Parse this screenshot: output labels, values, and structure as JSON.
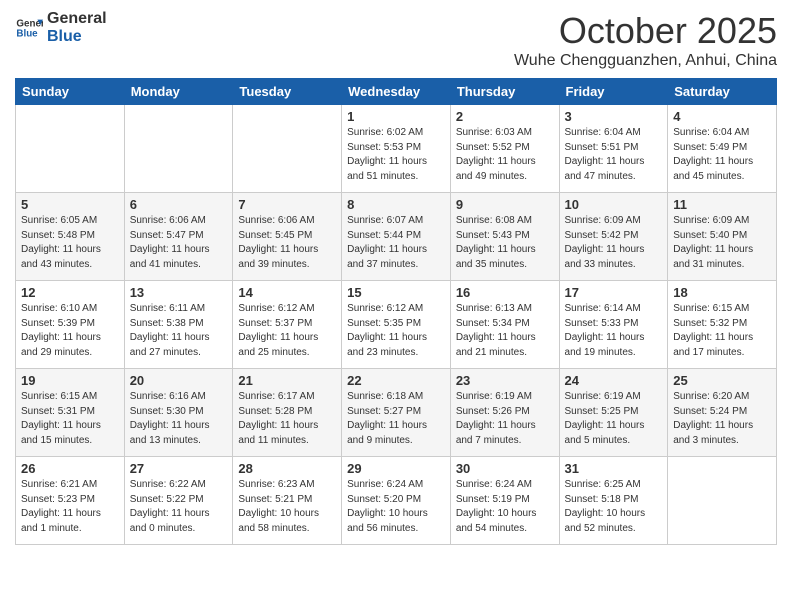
{
  "header": {
    "logo_general": "General",
    "logo_blue": "Blue",
    "month": "October 2025",
    "location": "Wuhe Chengguanzhen, Anhui, China"
  },
  "weekdays": [
    "Sunday",
    "Monday",
    "Tuesday",
    "Wednesday",
    "Thursday",
    "Friday",
    "Saturday"
  ],
  "weeks": [
    [
      {
        "day": "",
        "info": ""
      },
      {
        "day": "",
        "info": ""
      },
      {
        "day": "",
        "info": ""
      },
      {
        "day": "1",
        "info": "Sunrise: 6:02 AM\nSunset: 5:53 PM\nDaylight: 11 hours\nand 51 minutes."
      },
      {
        "day": "2",
        "info": "Sunrise: 6:03 AM\nSunset: 5:52 PM\nDaylight: 11 hours\nand 49 minutes."
      },
      {
        "day": "3",
        "info": "Sunrise: 6:04 AM\nSunset: 5:51 PM\nDaylight: 11 hours\nand 47 minutes."
      },
      {
        "day": "4",
        "info": "Sunrise: 6:04 AM\nSunset: 5:49 PM\nDaylight: 11 hours\nand 45 minutes."
      }
    ],
    [
      {
        "day": "5",
        "info": "Sunrise: 6:05 AM\nSunset: 5:48 PM\nDaylight: 11 hours\nand 43 minutes."
      },
      {
        "day": "6",
        "info": "Sunrise: 6:06 AM\nSunset: 5:47 PM\nDaylight: 11 hours\nand 41 minutes."
      },
      {
        "day": "7",
        "info": "Sunrise: 6:06 AM\nSunset: 5:45 PM\nDaylight: 11 hours\nand 39 minutes."
      },
      {
        "day": "8",
        "info": "Sunrise: 6:07 AM\nSunset: 5:44 PM\nDaylight: 11 hours\nand 37 minutes."
      },
      {
        "day": "9",
        "info": "Sunrise: 6:08 AM\nSunset: 5:43 PM\nDaylight: 11 hours\nand 35 minutes."
      },
      {
        "day": "10",
        "info": "Sunrise: 6:09 AM\nSunset: 5:42 PM\nDaylight: 11 hours\nand 33 minutes."
      },
      {
        "day": "11",
        "info": "Sunrise: 6:09 AM\nSunset: 5:40 PM\nDaylight: 11 hours\nand 31 minutes."
      }
    ],
    [
      {
        "day": "12",
        "info": "Sunrise: 6:10 AM\nSunset: 5:39 PM\nDaylight: 11 hours\nand 29 minutes."
      },
      {
        "day": "13",
        "info": "Sunrise: 6:11 AM\nSunset: 5:38 PM\nDaylight: 11 hours\nand 27 minutes."
      },
      {
        "day": "14",
        "info": "Sunrise: 6:12 AM\nSunset: 5:37 PM\nDaylight: 11 hours\nand 25 minutes."
      },
      {
        "day": "15",
        "info": "Sunrise: 6:12 AM\nSunset: 5:35 PM\nDaylight: 11 hours\nand 23 minutes."
      },
      {
        "day": "16",
        "info": "Sunrise: 6:13 AM\nSunset: 5:34 PM\nDaylight: 11 hours\nand 21 minutes."
      },
      {
        "day": "17",
        "info": "Sunrise: 6:14 AM\nSunset: 5:33 PM\nDaylight: 11 hours\nand 19 minutes."
      },
      {
        "day": "18",
        "info": "Sunrise: 6:15 AM\nSunset: 5:32 PM\nDaylight: 11 hours\nand 17 minutes."
      }
    ],
    [
      {
        "day": "19",
        "info": "Sunrise: 6:15 AM\nSunset: 5:31 PM\nDaylight: 11 hours\nand 15 minutes."
      },
      {
        "day": "20",
        "info": "Sunrise: 6:16 AM\nSunset: 5:30 PM\nDaylight: 11 hours\nand 13 minutes."
      },
      {
        "day": "21",
        "info": "Sunrise: 6:17 AM\nSunset: 5:28 PM\nDaylight: 11 hours\nand 11 minutes."
      },
      {
        "day": "22",
        "info": "Sunrise: 6:18 AM\nSunset: 5:27 PM\nDaylight: 11 hours\nand 9 minutes."
      },
      {
        "day": "23",
        "info": "Sunrise: 6:19 AM\nSunset: 5:26 PM\nDaylight: 11 hours\nand 7 minutes."
      },
      {
        "day": "24",
        "info": "Sunrise: 6:19 AM\nSunset: 5:25 PM\nDaylight: 11 hours\nand 5 minutes."
      },
      {
        "day": "25",
        "info": "Sunrise: 6:20 AM\nSunset: 5:24 PM\nDaylight: 11 hours\nand 3 minutes."
      }
    ],
    [
      {
        "day": "26",
        "info": "Sunrise: 6:21 AM\nSunset: 5:23 PM\nDaylight: 11 hours\nand 1 minute."
      },
      {
        "day": "27",
        "info": "Sunrise: 6:22 AM\nSunset: 5:22 PM\nDaylight: 11 hours\nand 0 minutes."
      },
      {
        "day": "28",
        "info": "Sunrise: 6:23 AM\nSunset: 5:21 PM\nDaylight: 10 hours\nand 58 minutes."
      },
      {
        "day": "29",
        "info": "Sunrise: 6:24 AM\nSunset: 5:20 PM\nDaylight: 10 hours\nand 56 minutes."
      },
      {
        "day": "30",
        "info": "Sunrise: 6:24 AM\nSunset: 5:19 PM\nDaylight: 10 hours\nand 54 minutes."
      },
      {
        "day": "31",
        "info": "Sunrise: 6:25 AM\nSunset: 5:18 PM\nDaylight: 10 hours\nand 52 minutes."
      },
      {
        "day": "",
        "info": ""
      }
    ]
  ]
}
